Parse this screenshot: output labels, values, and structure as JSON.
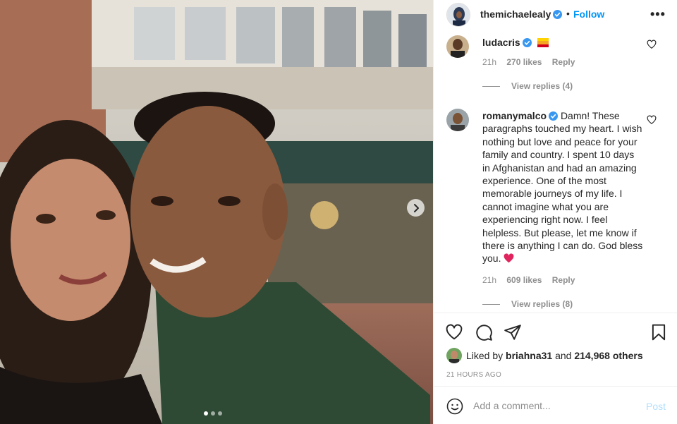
{
  "post": {
    "username": "themichaelealy",
    "bullet": "•",
    "follow_label": "Follow",
    "more_label": "•••",
    "photo_count": 3,
    "active_photo": 1
  },
  "comments": [
    {
      "username": "ludacris",
      "text": "",
      "time": "21h",
      "likes": "270 likes",
      "reply_label": "Reply",
      "view_replies": "View replies (4)"
    },
    {
      "username": "romanymalco",
      "text": "Damn! These paragraphs touched my heart. I wish nothing but love and peace for your family and country. I spent 10 days in Afghanistan and had an amazing experience. One of the most memorable journeys of my life. I cannot imagine what you are experiencing right now. I feel helpless. But please, let me know if there is anything I can do. God bless you.",
      "time": "21h",
      "likes": "609 likes",
      "reply_label": "Reply",
      "view_replies": "View replies (8)"
    }
  ],
  "likes": {
    "prefix": "Liked by",
    "user": "briahna31",
    "and": "and",
    "count": "214,968 others"
  },
  "timestamp": "21 HOURS AGO",
  "add_comment": {
    "placeholder": "Add a comment...",
    "post_label": "Post"
  },
  "icons": {
    "like": "heart-icon",
    "comment": "comment-bubble-icon",
    "share": "paper-plane-icon",
    "save": "bookmark-icon",
    "emoji": "smiley-icon",
    "next": "chevron-right-icon",
    "verified": "verified-badge-icon"
  },
  "colors": {
    "accent": "#0095f6",
    "verified": "#3897f0",
    "post_disabled": "#b2dffc",
    "secondary_text": "#8e8e8e",
    "heart": "#e0245e"
  }
}
